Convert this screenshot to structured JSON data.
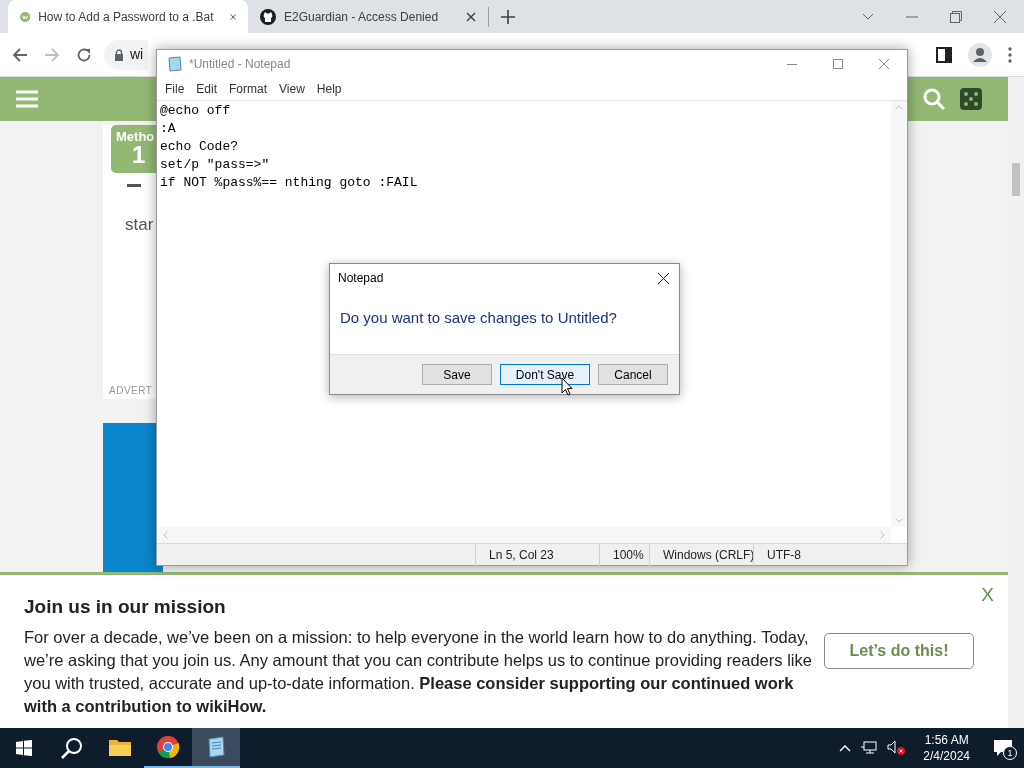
{
  "browser": {
    "tabs": [
      {
        "title": "How to Add a Password to a .Bat",
        "selected": true,
        "kind": "wikihow"
      },
      {
        "title": "E2Guardian - Access Denied",
        "selected": false,
        "kind": "github"
      }
    ],
    "address": "wi"
  },
  "page": {
    "method_label": "Metho",
    "method_number": "1",
    "fragment": "star",
    "ad_label": "ADVERT"
  },
  "banner": {
    "title": "Join us in our mission",
    "body": "For over a decade, we’ve been on a mission: to help everyone in the world learn how to do anything. Today, we’re asking that you join us. Any amount that you can contribute helps us to continue providing readers like you with trusted, accurate and up-to-date information. **Please consider supporting our continued work with a contribution to wikiHow.**",
    "button": "Let’s do this!",
    "close": "X"
  },
  "notepad": {
    "title": "*Untitled - Notepad",
    "menu": [
      "File",
      "Edit",
      "Format",
      "View",
      "Help"
    ],
    "lines": [
      "@echo off",
      ":A",
      "echo Code?",
      "set/p \"pass=>\"",
      "if NOT %pass%== nthing goto :FAIL"
    ],
    "status": [
      "Ln 5, Col 23",
      "100%",
      "Windows (CRLF)",
      "UTF-8"
    ]
  },
  "dialog": {
    "title": "Notepad",
    "message": "Do you want to save changes to Untitled?",
    "buttons": [
      {
        "label": "Save",
        "selected": false
      },
      {
        "label": "Don't Save",
        "selected": true
      },
      {
        "label": "Cancel",
        "selected": false
      }
    ]
  },
  "taskbar": {
    "apps": [
      {
        "kind": "explorer",
        "running": false,
        "selected": false
      },
      {
        "kind": "chrome",
        "running": true,
        "selected": false
      },
      {
        "kind": "notepad",
        "running": true,
        "selected": true
      }
    ],
    "time": "1:56 AM",
    "date": "2/4/2024",
    "notifications": "1"
  }
}
